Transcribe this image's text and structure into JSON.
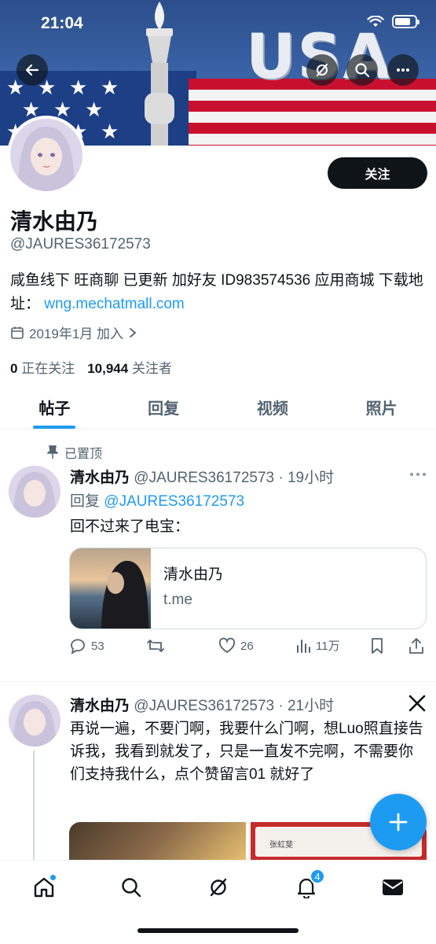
{
  "status_bar": {
    "time": "21:04"
  },
  "banner": {
    "text": "USA"
  },
  "profile": {
    "follow_label": "关注",
    "display_name": "清水由乃",
    "handle": "@JAURES36172573",
    "bio_text": "咸鱼线下 旺商聊 已更新 加好友 ID983574536 应用商城 下载地址：",
    "bio_link": "wng.mechatmall.com",
    "joined": "2019年1月 加入",
    "following_count": "0",
    "following_label": "正在关注",
    "followers_count": "10,944",
    "followers_label": "关注者"
  },
  "tabs": [
    {
      "label": "帖子",
      "active": true
    },
    {
      "label": "回复",
      "active": false
    },
    {
      "label": "视频",
      "active": false
    },
    {
      "label": "照片",
      "active": false
    }
  ],
  "posts": [
    {
      "pinned_label": "已置顶",
      "name": "清水由乃",
      "meta": "@JAURES36172573 · 19小时",
      "reply_prefix": "回复",
      "reply_handle": "@JAURES36172573",
      "text": "回不过来了电宝：",
      "card": {
        "title": "清水由乃",
        "domain": "t.me"
      },
      "replies": "53",
      "likes": "26",
      "views": "11万"
    },
    {
      "name": "清水由乃",
      "meta": "@JAURES36172573 · 21小时",
      "text": "再说一遍，不要门啊，我要什么门啊，想Luo照直接告诉我，我看到就发了，只是一直发不完啊，不需要你们支持我什么，点个赞留言01 就好了",
      "media_text": "张虹斐"
    }
  ],
  "nav": {
    "notifications_count": "4"
  },
  "colors": {
    "accent": "#1d9bf0",
    "text": "#0f1419",
    "muted": "#536471"
  }
}
